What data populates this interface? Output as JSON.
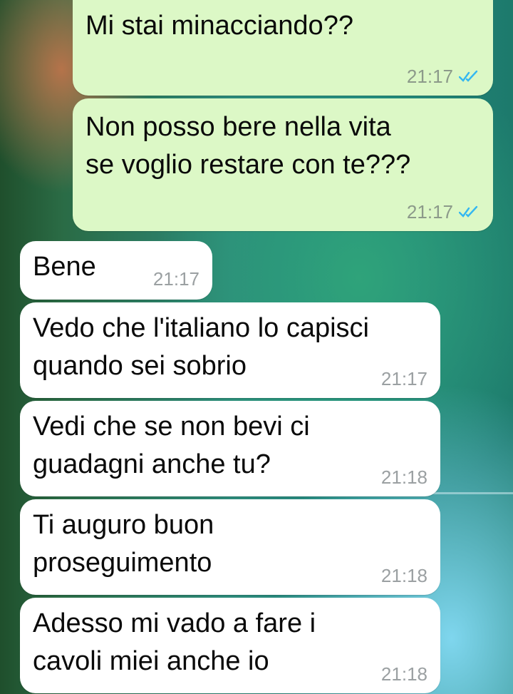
{
  "messages": [
    {
      "direction": "outgoing",
      "text": "Mi stai minacciando??",
      "time": "21:17",
      "status": "read"
    },
    {
      "direction": "outgoing",
      "text": "Non posso bere nella vita\nse voglio restare con te???",
      "time": "21:17",
      "status": "read"
    },
    {
      "direction": "incoming",
      "text": "Bene",
      "time": "21:17"
    },
    {
      "direction": "incoming",
      "text": "Vedo che l'italiano lo capisci\nquando sei sobrio",
      "time": "21:17"
    },
    {
      "direction": "incoming",
      "text": "Vedi che se non bevi ci\nguadagni anche tu?",
      "time": "21:18"
    },
    {
      "direction": "incoming",
      "text": "Ti auguro buon\nproseguimento",
      "time": "21:18"
    },
    {
      "direction": "incoming",
      "text": "Adesso mi vado a fare i\ncavoli miei anche io",
      "time": "21:18"
    }
  ],
  "colors": {
    "outgoing_bubble": "#dcf8c6",
    "incoming_bubble": "#ffffff",
    "read_ticks": "#34b7f1",
    "timestamp": "#8c9a8a"
  },
  "icons": {
    "read_receipt": "double-check-icon"
  }
}
